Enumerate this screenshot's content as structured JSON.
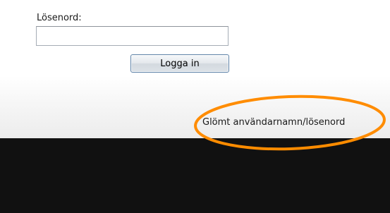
{
  "login_form": {
    "password_label": "Lösenord:",
    "password_value": "",
    "login_button_label": "Logga in",
    "forgot_link_label": "Glömt användarnamn/lösenord"
  },
  "annotation": {
    "highlight_color": "#ff8c00"
  },
  "colors": {
    "bottom_panel": "#111111",
    "button_border": "#5f83a8"
  }
}
